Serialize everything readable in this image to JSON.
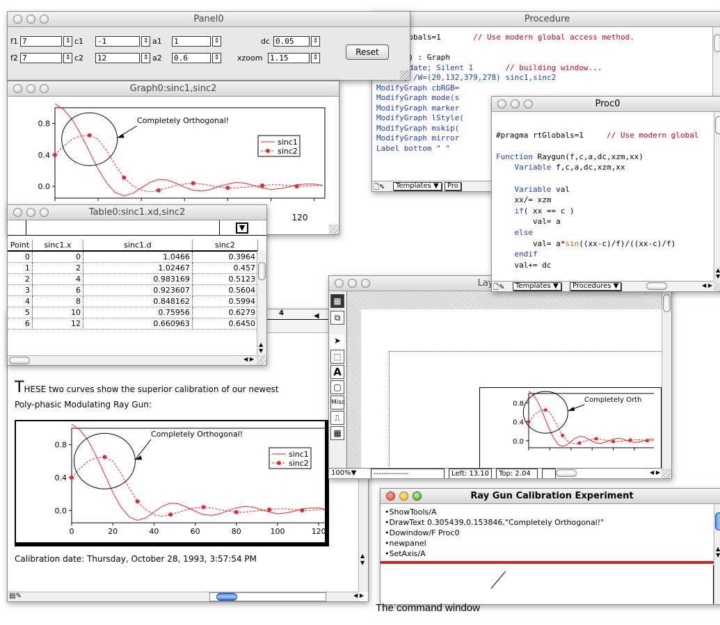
{
  "panel": {
    "title": "Panel0",
    "row1": {
      "f1_label": "f1",
      "f1": "7",
      "c1_label": "c1",
      "c1": "-1",
      "a1_label": "a1",
      "a1": "1",
      "dc_label": "dc",
      "dc": "0.05"
    },
    "row2": {
      "f2_label": "f2",
      "f2": "7",
      "c2_label": "c2",
      "c2": "12",
      "a2_label": "a2",
      "a2": "0.6",
      "xzoom_label": "xzoom",
      "xzoom": "1.15"
    },
    "reset_label": "Reset"
  },
  "procedure": {
    "title": "Procedure",
    "lines": [
      {
        "t": "na rtGlobals=1       ",
        "c": "// Use modern global access method."
      },
      {
        "t": ""
      },
      {
        "t": "GraphO() : Graph"
      },
      {
        "t": "PauseUpdate; Silent 1       ",
        "c": "// building window..."
      },
      {
        "t": "Display /W=(20,132,379,278) sinc1,sinc2"
      },
      {
        "t": "ModifyGraph cbRGB="
      },
      {
        "t": "ModifyGraph mode(s"
      },
      {
        "t": "ModifyGraph marker"
      },
      {
        "t": "ModifyGraph lStyle("
      },
      {
        "t": "ModifyGraph mskip("
      },
      {
        "t": "ModifyGraph mirror"
      },
      {
        "t": "Label bottom \" \""
      }
    ],
    "templates_label": "Templates",
    "procedures_label": "Pro"
  },
  "proc0": {
    "title": "Proc0",
    "pragma": "#pragma rtGlobals=1",
    "pragma_comment": "// Use modern global",
    "func_kw": "Function",
    "func_sig": " Raygun(f,c,a,dc,xzm,xx)",
    "var_kw": "Variable",
    "var_list": " f,c,a,dc,xzm,xx",
    "var_kw2": "Variable",
    "var_val": " val",
    "line_xx": "xx/= xzm",
    "if_kw": "if",
    "if_cond": "( xx == c )",
    "val_a": "val= a",
    "else_kw": "else",
    "val_sin_pre": "val= a*",
    "sin_fn": "sin",
    "val_sin_post": "((xx-c)/f)/((xx-c)/f)",
    "endif_kw": "endif",
    "val_dc": "val+= dc",
    "templates_label": "Templates",
    "procedures_label": "Procedures"
  },
  "graph0": {
    "title": "Graph0:sinc1,sinc2",
    "annotation": "Completely Orthogonal!",
    "x_tick_visible": "120"
  },
  "table0": {
    "title": "Table0:sinc1.xd,sinc2",
    "headers": [
      "Point",
      "sinc1.x",
      "sinc1.d",
      "sinc2"
    ],
    "rows": [
      [
        "0",
        "0",
        "1.0466",
        "0.3964"
      ],
      [
        "1",
        "2",
        "1.02467",
        "0.457"
      ],
      [
        "2",
        "4",
        "0.983169",
        "0.5123"
      ],
      [
        "3",
        "6",
        "0.923607",
        "0.5604"
      ],
      [
        "4",
        "8",
        "0.848162",
        "0.5994"
      ],
      [
        "5",
        "10",
        "0.75956",
        "0.6279"
      ],
      [
        "6",
        "12",
        "0.660963",
        "0.6450"
      ]
    ]
  },
  "notebook": {
    "dropcap": "T",
    "para1": "HESE two curves show the superior calibration of our newest",
    "para2": "Poly-phasic Modulating Ray Gun:",
    "annotation": "Completely Orthogonal!",
    "calibration": "Calibration date: Thursday, October 28, 1993, 3:57:54 PM",
    "ruler_mark": "4"
  },
  "layout": {
    "title": "Layout0:T",
    "zoom": "100%",
    "dashes": "--------------",
    "left": "Left: 13.10",
    "top": "Top: 2.04",
    "annotation": "Completely Orth",
    "tool_text": "A",
    "tool_misc": "Misc"
  },
  "command": {
    "title": "Ray Gun Calibration Experiment",
    "history": [
      "•ShowTools/A",
      "•DrawText 0.305439,0.153846,\"Completely Orthogonal!\"",
      "•Dowindow/F Proc0",
      "•newpanel",
      "•SetAxis/A"
    ]
  },
  "caption": "The command window",
  "chart_data": {
    "type": "line",
    "xlim": [
      0,
      125
    ],
    "ylim": [
      -0.15,
      1.0
    ],
    "x_ticks": [
      0,
      20,
      40,
      60,
      80,
      100,
      120
    ],
    "y_ticks": [
      0.0,
      0.4,
      0.8
    ],
    "series": [
      {
        "name": "sinc1",
        "style": "solid",
        "color": "#ee2222",
        "x": [
          0,
          4,
          8,
          12,
          16,
          20,
          24,
          28,
          32,
          36,
          40,
          44,
          48,
          52,
          56,
          60,
          64,
          68,
          72,
          76,
          80,
          84,
          88,
          92,
          96,
          100,
          104,
          108,
          112,
          116,
          120,
          124
        ],
        "y": [
          1.05,
          0.98,
          0.85,
          0.66,
          0.44,
          0.22,
          0.04,
          -0.08,
          -0.12,
          -0.09,
          -0.02,
          0.05,
          0.09,
          0.08,
          0.04,
          -0.01,
          -0.05,
          -0.06,
          -0.04,
          0.0,
          0.03,
          0.05,
          0.04,
          0.01,
          -0.02,
          -0.04,
          -0.03,
          -0.01,
          0.02,
          0.03,
          0.03,
          0.01
        ]
      },
      {
        "name": "sinc2",
        "style": "dashed",
        "color": "#ee2222",
        "x": [
          0,
          4,
          8,
          12,
          16,
          20,
          24,
          28,
          32,
          36,
          40,
          44,
          48,
          52,
          56,
          60,
          64,
          68,
          72,
          76,
          80,
          84,
          88,
          92,
          96,
          100,
          104,
          108,
          112,
          116,
          120,
          124
        ],
        "y": [
          0.4,
          0.51,
          0.6,
          0.64,
          0.65,
          0.6,
          0.45,
          0.27,
          0.11,
          0.01,
          -0.05,
          -0.07,
          -0.05,
          -0.02,
          0.01,
          0.03,
          0.04,
          0.03,
          0.01,
          -0.01,
          -0.02,
          -0.02,
          -0.01,
          0.0,
          0.01,
          0.02,
          0.02,
          0.01,
          0.0,
          0.0,
          0.01,
          0.01
        ],
        "marker_x": [
          0,
          16,
          32,
          48,
          64,
          80,
          96,
          112
        ],
        "marker_y": [
          0.4,
          0.65,
          0.11,
          -0.05,
          0.04,
          -0.02,
          0.01,
          0.0
        ]
      }
    ]
  }
}
